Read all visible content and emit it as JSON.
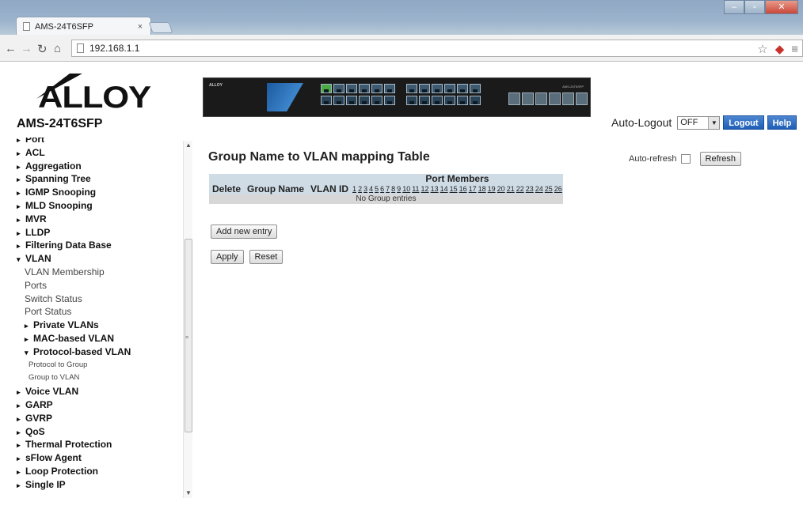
{
  "browser": {
    "tab_title": "AMS-24T6SFP",
    "tab_close": "×",
    "url": "192.168.1.1",
    "window_controls": [
      "minimize",
      "maximize",
      "close"
    ],
    "icons": [
      "back-icon",
      "forward-icon",
      "reload-icon",
      "home-icon",
      "star-icon",
      "extension-icon",
      "menu-icon"
    ]
  },
  "header": {
    "brand_logo_text": "ALLOY",
    "model": "AMS-24T6SFP",
    "device_label": "AMS-24T6SFP",
    "auto_logout_label": "Auto-Logout",
    "auto_logout_value": "OFF",
    "logout_label": "Logout",
    "help_label": "Help"
  },
  "sidebar": {
    "items": [
      {
        "label": "Port",
        "level": 0,
        "arrow": "▸"
      },
      {
        "label": "ACL",
        "level": 0,
        "arrow": "▸"
      },
      {
        "label": "Aggregation",
        "level": 0,
        "arrow": "▸"
      },
      {
        "label": "Spanning Tree",
        "level": 0,
        "arrow": "▸"
      },
      {
        "label": "IGMP Snooping",
        "level": 0,
        "arrow": "▸"
      },
      {
        "label": "MLD Snooping",
        "level": 0,
        "arrow": "▸"
      },
      {
        "label": "MVR",
        "level": 0,
        "arrow": "▸"
      },
      {
        "label": "LLDP",
        "level": 0,
        "arrow": "▸"
      },
      {
        "label": "Filtering Data Base",
        "level": 0,
        "arrow": "▸"
      },
      {
        "label": "VLAN",
        "level": 0,
        "arrow": "▾"
      },
      {
        "label": "VLAN Membership",
        "level": 1
      },
      {
        "label": "Ports",
        "level": 1
      },
      {
        "label": "Switch Status",
        "level": 1
      },
      {
        "label": "Port Status",
        "level": 1
      },
      {
        "label": "Private VLANs",
        "level": 2,
        "arrow": "▸"
      },
      {
        "label": "MAC-based VLAN",
        "level": 2,
        "arrow": "▸"
      },
      {
        "label": "Protocol-based VLAN",
        "level": 2,
        "arrow": "▾"
      },
      {
        "label": "Protocol to Group",
        "level": 3
      },
      {
        "label": "Group to VLAN",
        "level": 3
      },
      {
        "label": "Voice VLAN",
        "level": 0,
        "arrow": "▸"
      },
      {
        "label": "GARP",
        "level": 0,
        "arrow": "▸"
      },
      {
        "label": "GVRP",
        "level": 0,
        "arrow": "▸"
      },
      {
        "label": "QoS",
        "level": 0,
        "arrow": "▸"
      },
      {
        "label": "Thermal Protection",
        "level": 0,
        "arrow": "▸"
      },
      {
        "label": "sFlow Agent",
        "level": 0,
        "arrow": "▸"
      },
      {
        "label": "Loop Protection",
        "level": 0,
        "arrow": "▸"
      },
      {
        "label": "Single IP",
        "level": 0,
        "arrow": "▸"
      }
    ]
  },
  "main": {
    "title": "Group Name to VLAN mapping Table",
    "auto_refresh_label": "Auto-refresh",
    "auto_refresh_checked": false,
    "refresh_label": "Refresh",
    "table": {
      "port_members_label": "Port Members",
      "col_delete": "Delete",
      "col_group_name": "Group Name",
      "col_vlan_id": "VLAN ID",
      "ports": [
        "1",
        "2",
        "3",
        "4",
        "5",
        "6",
        "7",
        "8",
        "9",
        "10",
        "11",
        "12",
        "13",
        "14",
        "15",
        "16",
        "17",
        "18",
        "19",
        "20",
        "21",
        "22",
        "23",
        "24",
        "25",
        "26"
      ],
      "empty_message": "No Group entries"
    },
    "add_new_entry_label": "Add new entry",
    "apply_label": "Apply",
    "reset_label": "Reset"
  }
}
